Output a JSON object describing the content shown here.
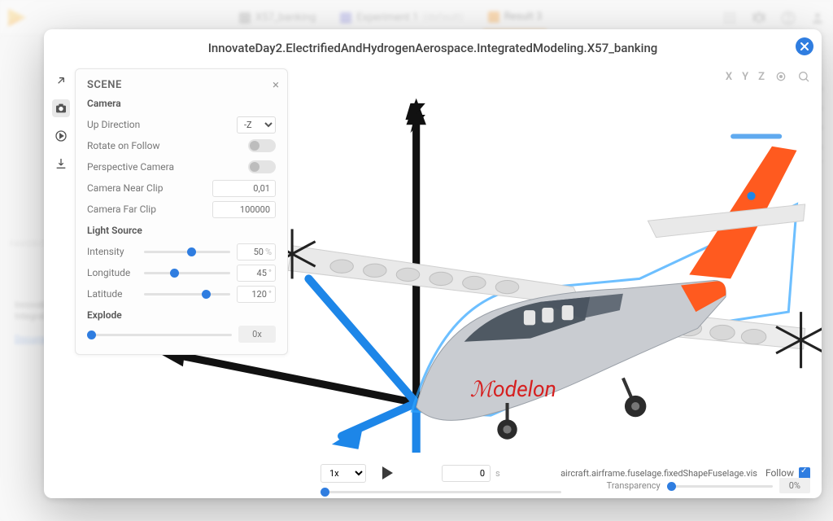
{
  "topbar": {
    "tabs": [
      {
        "icon": "grid",
        "label": "X57_banking"
      },
      {
        "icon": "flask",
        "label": "Experiment 1",
        "suffix": "(default)"
      },
      {
        "icon": "chart",
        "label": "Result 3",
        "active": true
      }
    ]
  },
  "background": {
    "favorites_label": "FAVORIT",
    "line1": "Innovate",
    "line2": "Integrat",
    "doclink": "Document"
  },
  "modal": {
    "title": "InnovateDay2.ElectrifiedAndHydrogenAerospace.IntegratedModeling.X57_banking",
    "scene": {
      "heading": "SCENE",
      "camera_label": "Camera",
      "up_direction": {
        "label": "Up Direction",
        "value": "-Z"
      },
      "rotate_on_follow": "Rotate on Follow",
      "perspective": "Perspective Camera",
      "near_clip": {
        "label": "Camera Near Clip",
        "value": "0,01"
      },
      "far_clip": {
        "label": "Camera Far Clip",
        "value": "100000"
      },
      "light_label": "Light Source",
      "intensity": {
        "label": "Intensity",
        "value": "50",
        "unit": "%",
        "pos": 50
      },
      "longitude": {
        "label": "Longitude",
        "value": "45",
        "unit": "°",
        "pos": 30
      },
      "latitude": {
        "label": "Latitude",
        "value": "120",
        "unit": "°",
        "pos": 67
      },
      "explode": {
        "label": "Explode",
        "button": "0x",
        "pos": 0
      }
    },
    "axis_buttons": [
      "X",
      "Y",
      "Z"
    ],
    "playback": {
      "speed": "1x",
      "time": "0",
      "time_unit": "s",
      "timeline_pos": 0
    },
    "selection_path": "aircraft.airframe.fuselage.fixedShapeFuselage.vis",
    "follow": {
      "label": "Follow",
      "checked": true
    },
    "transparency": {
      "label": "Transparency",
      "value": "0%",
      "pos": 0
    },
    "brand": "Modelon"
  }
}
